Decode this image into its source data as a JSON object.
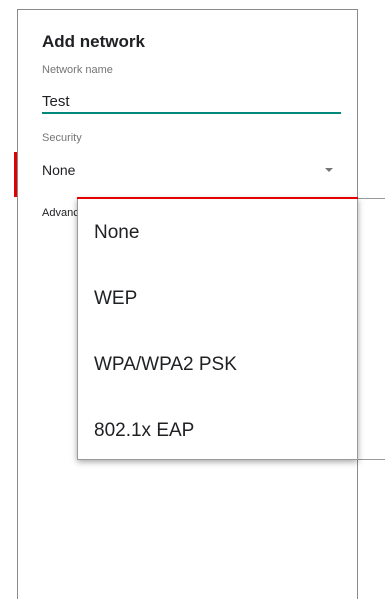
{
  "dialog": {
    "title": "Add network",
    "network_name_label": "Network name",
    "network_name_value": "Test",
    "security_label": "Security",
    "security_value": "None",
    "advanced_label": "Advanced options"
  },
  "security_dropdown": {
    "options": [
      "None",
      "WEP",
      "WPA/WPA2 PSK",
      "802.1x EAP"
    ]
  },
  "colors": {
    "accent": "#00897b",
    "highlight_red": "#e30000"
  },
  "icons": {
    "dropdown": "chevron-down-icon"
  }
}
